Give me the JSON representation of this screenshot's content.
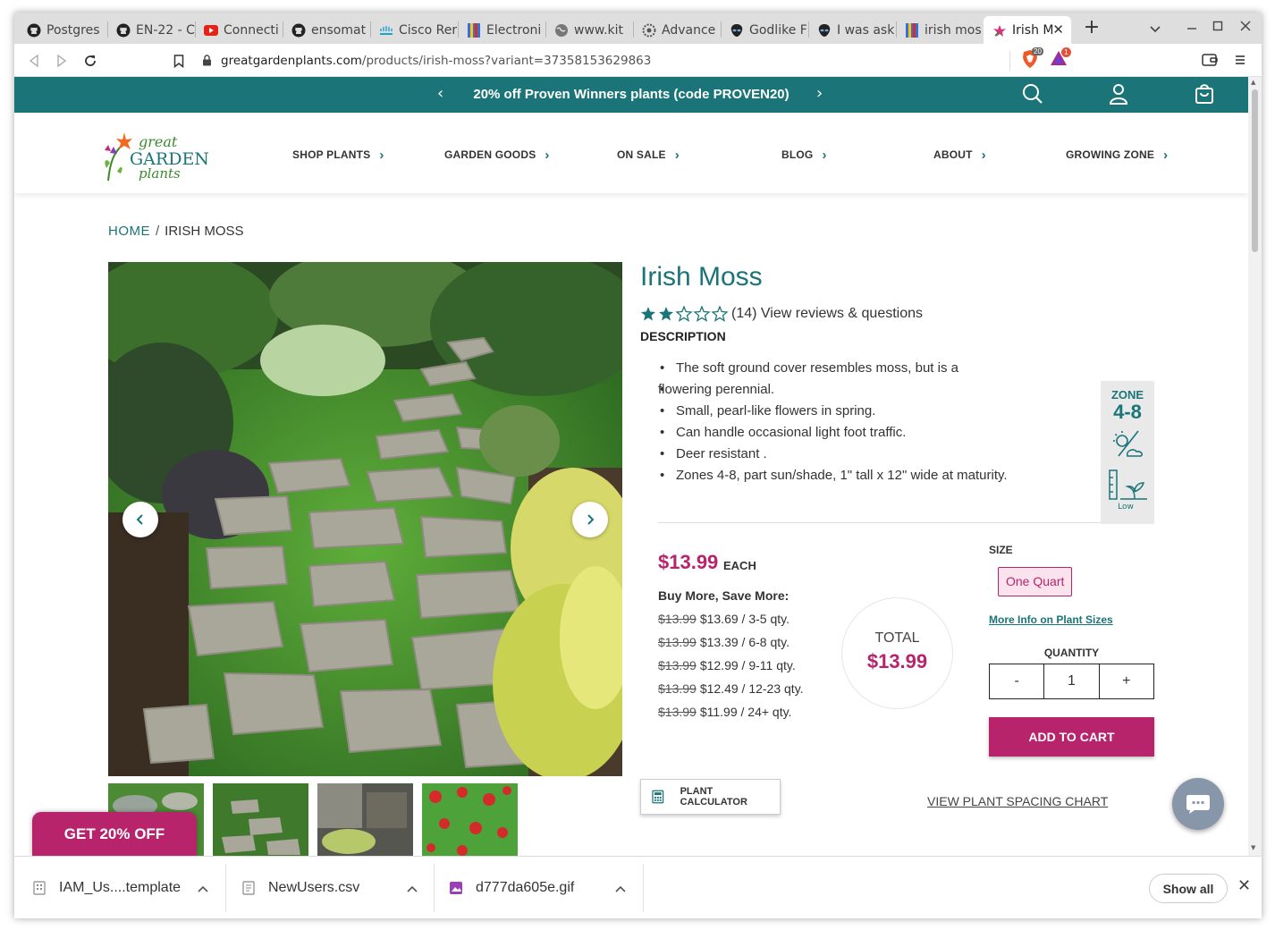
{
  "browser": {
    "tabs": [
      {
        "title": "Postgres",
        "icon": "github-icon"
      },
      {
        "title": "EN-22 - C",
        "icon": "github-icon"
      },
      {
        "title": "Connecti",
        "icon": "youtube-icon"
      },
      {
        "title": "ensomat",
        "icon": "github-icon"
      },
      {
        "title": "Cisco Rer",
        "icon": "cisco-icon"
      },
      {
        "title": "Electroni",
        "icon": "bookmark-icon"
      },
      {
        "title": "www.kit",
        "icon": "globe-icon"
      },
      {
        "title": "Advance",
        "icon": "gear-icon"
      },
      {
        "title": "Godlike F",
        "icon": "alien-icon"
      },
      {
        "title": "I was ask",
        "icon": "alien-icon"
      },
      {
        "title": "irish mos",
        "icon": "bookmark-icon"
      },
      {
        "title": "Irish M",
        "icon": "flower-icon",
        "active": true
      }
    ],
    "url_domain": "greatgardenplants.com",
    "url_path": "/products/irish-moss?variant=37358153629863",
    "brave_badge": "20",
    "rewards_badge": "1"
  },
  "promo": {
    "text": "20% off Proven Winners plants (code PROVEN20)"
  },
  "logo": {
    "line1": "great",
    "line2": "GARDEN",
    "line3": "plants"
  },
  "nav": {
    "items": [
      "SHOP PLANTS",
      "GARDEN GOODS",
      "ON SALE",
      "BLOG",
      "ABOUT",
      "GROWING ZONE"
    ]
  },
  "breadcrumb": {
    "home": "HOME",
    "separator": "/",
    "current": "IRISH MOSS"
  },
  "product": {
    "title": "Irish Moss",
    "rating": 2.5,
    "rating_max": 5,
    "reviews_text": "(14) View reviews & questions",
    "description_heading": "DESCRIPTION",
    "description": [
      "The soft ground cover resembles moss, but is a",
      "flowering perennial.",
      "Small, pearl-like flowers in spring.",
      "Can handle occasional light foot traffic.",
      "Deer resistant .",
      "Zones 4-8, part sun/shade, 1\" tall x 12\" wide at maturity."
    ],
    "zone_label": "ZONE",
    "zone_value": "4-8",
    "water_label": "Low",
    "price": "$13.99",
    "price_unit": "EACH",
    "buy_more_label": "Buy More, Save More:",
    "tiers": [
      {
        "old": "$13.99",
        "new": "$13.69 / 3-5 qty."
      },
      {
        "old": "$13.99",
        "new": "$13.39 / 6-8 qty."
      },
      {
        "old": "$13.99",
        "new": "$12.99 / 9-11 qty."
      },
      {
        "old": "$13.99",
        "new": "$12.49 / 12-23 qty."
      },
      {
        "old": "$13.99",
        "new": "$11.99 / 24+ qty."
      }
    ],
    "total_label": "TOTAL",
    "total_value": "$13.99",
    "size_label": "SIZE",
    "size_option": "One Quart",
    "size_info": "More Info on Plant Sizes",
    "quantity_label": "QUANTITY",
    "qty_minus": "-",
    "qty_value": "1",
    "qty_plus": "+",
    "add_to_cart": "ADD TO CART",
    "plant_calculator": "PLANT CALCULATOR",
    "spacing_chart": "VIEW PLANT SPACING CHART"
  },
  "popup": {
    "get_off": "GET 20% OFF"
  },
  "downloads": {
    "items": [
      "IAM_Us....template",
      "NewUsers.csv",
      "d777da605e.gif"
    ],
    "show_all": "Show all"
  },
  "colors": {
    "teal": "#1a7478",
    "magenta": "#b8246b"
  }
}
